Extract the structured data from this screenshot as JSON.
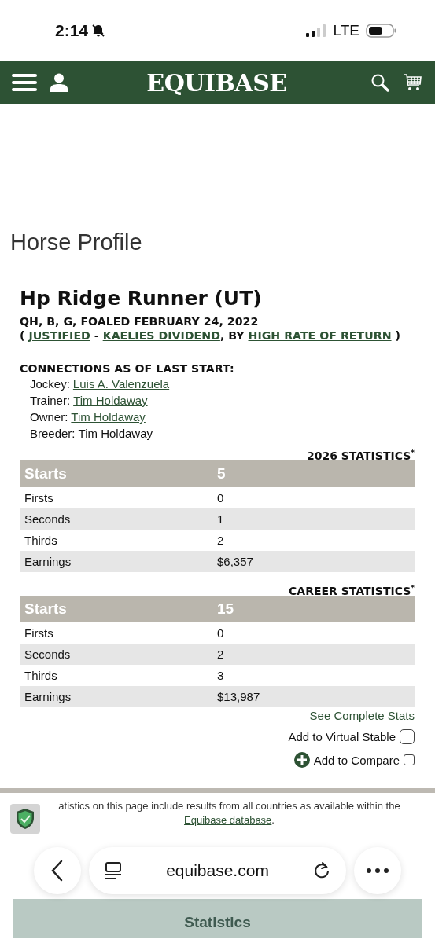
{
  "status_bar": {
    "time": "2:14",
    "network": "LTE"
  },
  "header": {
    "logo": "EQUIBASE"
  },
  "page_title": "Horse Profile",
  "horse": {
    "name": "Hp Ridge Runner (UT)",
    "details": "QH, B, G, FOALED FEBRUARY 24, 2022",
    "pedigree": [
      {
        "kind": "text",
        "text": "( "
      },
      {
        "kind": "link",
        "text": "JUSTIFIED"
      },
      {
        "kind": "text",
        "text": " - "
      },
      {
        "kind": "link",
        "text": "KAELIES DIVIDEND"
      },
      {
        "kind": "text",
        "text": ", BY "
      },
      {
        "kind": "link",
        "text": "HIGH RATE OF RETURN"
      },
      {
        "kind": "text",
        "text": " )"
      }
    ]
  },
  "connections": {
    "heading": "CONNECTIONS AS OF LAST START:",
    "items": [
      {
        "label": "Jockey:",
        "value": "Luis A. Valenzuela",
        "kind": "link"
      },
      {
        "label": "Trainer:",
        "value": "Tim Holdaway",
        "kind": "link"
      },
      {
        "label": "Owner:",
        "value": "Tim Holdaway",
        "kind": "link"
      },
      {
        "label": "Breeder:",
        "value": "Tim Holdaway",
        "kind": "text"
      }
    ]
  },
  "stat_tables": [
    {
      "title": "2026 STATISTICS",
      "mark": "*",
      "header": [
        "Starts",
        "5"
      ],
      "rows": [
        [
          "Firsts",
          "0"
        ],
        [
          "Seconds",
          "1"
        ],
        [
          "Thirds",
          "2"
        ],
        [
          "Earnings",
          "$6,357"
        ]
      ]
    },
    {
      "title": "CAREER STATISTICS",
      "mark": "*",
      "header": [
        "Starts",
        "15"
      ],
      "rows": [
        [
          "Firsts",
          "0"
        ],
        [
          "Seconds",
          "2"
        ],
        [
          "Thirds",
          "3"
        ],
        [
          "Earnings",
          "$13,987"
        ]
      ]
    }
  ],
  "complete_stats_link": "See Complete Stats",
  "virtual_stable": {
    "label": "Add to Virtual Stable",
    "checked": false
  },
  "compare": {
    "label": "Add to Compare",
    "checked": false
  },
  "notice": {
    "text": "atistics on this page include results from all countries as available within the ",
    "link": "Equibase database",
    "end": "."
  },
  "browser_bar": {
    "url": "equibase.com"
  },
  "bottom_button": "Statistics"
}
